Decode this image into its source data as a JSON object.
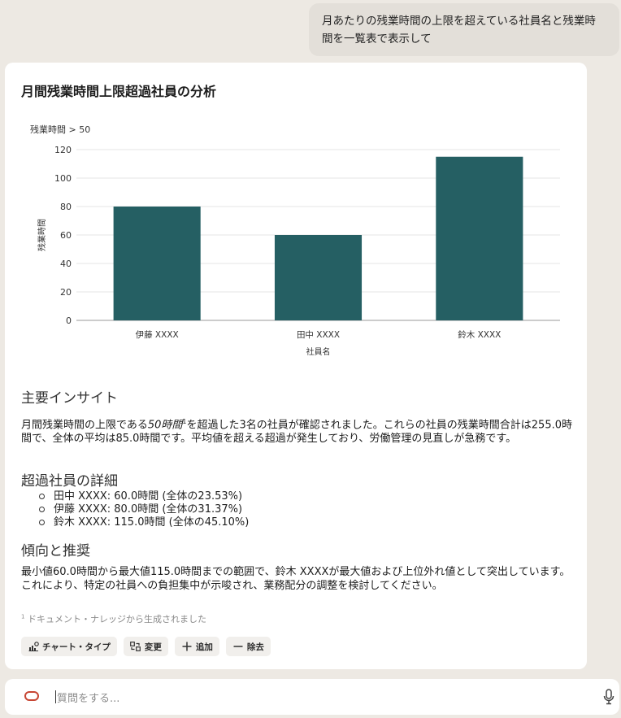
{
  "user_message": "月あたりの残業時間の上限を超えている社員名と残業時間を一覧表で表示して",
  "card": {
    "title": "月間残業時間上限超過社員の分析"
  },
  "chart_data": {
    "type": "bar",
    "title": "残業時間 > 50",
    "categories": [
      "伊藤 XXXX",
      "田中 XXXX",
      "鈴木 XXXX"
    ],
    "values": [
      80,
      60,
      115
    ],
    "xlabel": "社員名",
    "ylabel": "残業時間",
    "ylim": [
      0,
      120
    ],
    "yticks": [
      0,
      20,
      40,
      60,
      80,
      100,
      120
    ],
    "grid": true,
    "bar_color": "#255f63"
  },
  "insights": {
    "heading": "主要インサイト",
    "para_before": "月間残業時間の上限である",
    "para_italic": "50時間",
    "para_sup": "1",
    "para_after": "を超過した3名の社員が確認されました。これらの社員の残業時間合計は255.0時間で、全体の平均は85.0時間です。平均値を超える超過が発生しており、労働管理の見直しが急務です。"
  },
  "details": {
    "heading": "超過社員の詳細",
    "items": [
      "田中 XXXX: 60.0時間 (全体の23.53%)",
      "伊藤 XXXX: 80.0時間 (全体の31.37%)",
      "鈴木 XXXX: 115.0時間 (全体の45.10%)"
    ]
  },
  "trends": {
    "heading": "傾向と推奨",
    "text": "最小値60.0時間から最大値115.0時間までの範囲で、鈴木 XXXXが最大値および上位外れ値として突出しています。これにより、特定の社員への負担集中が示唆され、業務配分の調整を検討してください。"
  },
  "footnote": {
    "marker": "1",
    "text": "ドキュメント・ナレッジから生成されました"
  },
  "actions": {
    "chart_type": "チャート・タイプ",
    "change": "変更",
    "add": "追加",
    "remove": "除去"
  },
  "input": {
    "placeholder": "質問をする..."
  },
  "colors": {
    "accent_logo": "#c74634",
    "bar": "#255f63"
  }
}
